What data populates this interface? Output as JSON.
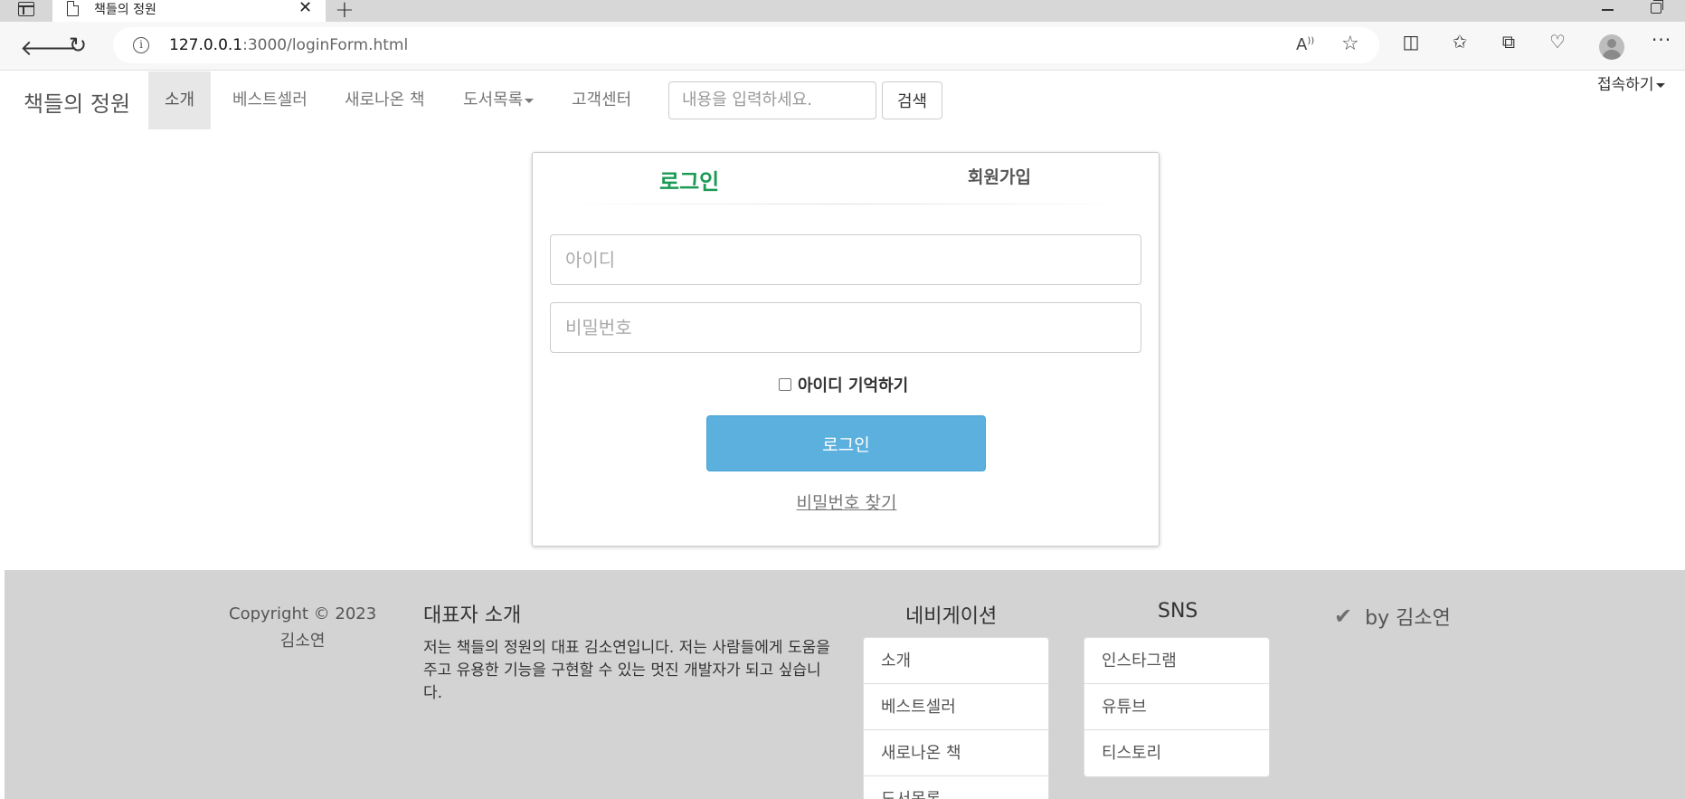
{
  "browser": {
    "tab_title": "책들의 정원",
    "tab_close": "✕",
    "new_tab": "+",
    "url_host": "127.0.0.1",
    "url_rest": ":3000/loginForm.html",
    "read_aloud": "À",
    "icons": [
      "sidebar-icon",
      "back-icon",
      "reload-icon",
      "info-icon",
      "read-aloud-icon",
      "favorite-star-icon",
      "split-screen-icon",
      "favorites-icon",
      "collections-icon",
      "health-icon",
      "profile-avatar",
      "more-icon"
    ]
  },
  "nav": {
    "brand": "책들의 정원",
    "items": [
      "소개",
      "베스트셀러",
      "새로나온 책",
      "도서목록",
      "고객센터"
    ],
    "search_placeholder": "내용을 입력하세요.",
    "search_button": "검색",
    "connect": "접속하기"
  },
  "login": {
    "tab_login": "로그인",
    "tab_join": "회원가입",
    "id_placeholder": "아이디",
    "pw_placeholder": "비밀번호",
    "remember_label": "아이디 기억하기",
    "remember_checked": false,
    "login_button": "로그인",
    "find_pw": "비밀번호 찾기"
  },
  "footer": {
    "copyright_line1": "Copyright © 2023",
    "copyright_line2": "김소연",
    "ceo_title": "대표자 소개",
    "ceo_text": "저는 책들의 정원의 대표 김소연입니다. 저는 사람들에게 도움을 주고 유용한 기능을 구현할 수 있는 멋진 개발자가 되고 싶습니다.",
    "nav_title": "네비게이션",
    "nav_links": [
      "소개",
      "베스트셀러",
      "새로나온 책",
      "도서목록"
    ],
    "sns_title": "SNS",
    "sns_links": [
      "인스타그램",
      "유튜브",
      "티스토리"
    ],
    "by": "by 김소연"
  },
  "colors": {
    "accent_green": "#1b9a55",
    "login_button": "#5bb0de",
    "footer_bg": "#d3d3d3"
  }
}
